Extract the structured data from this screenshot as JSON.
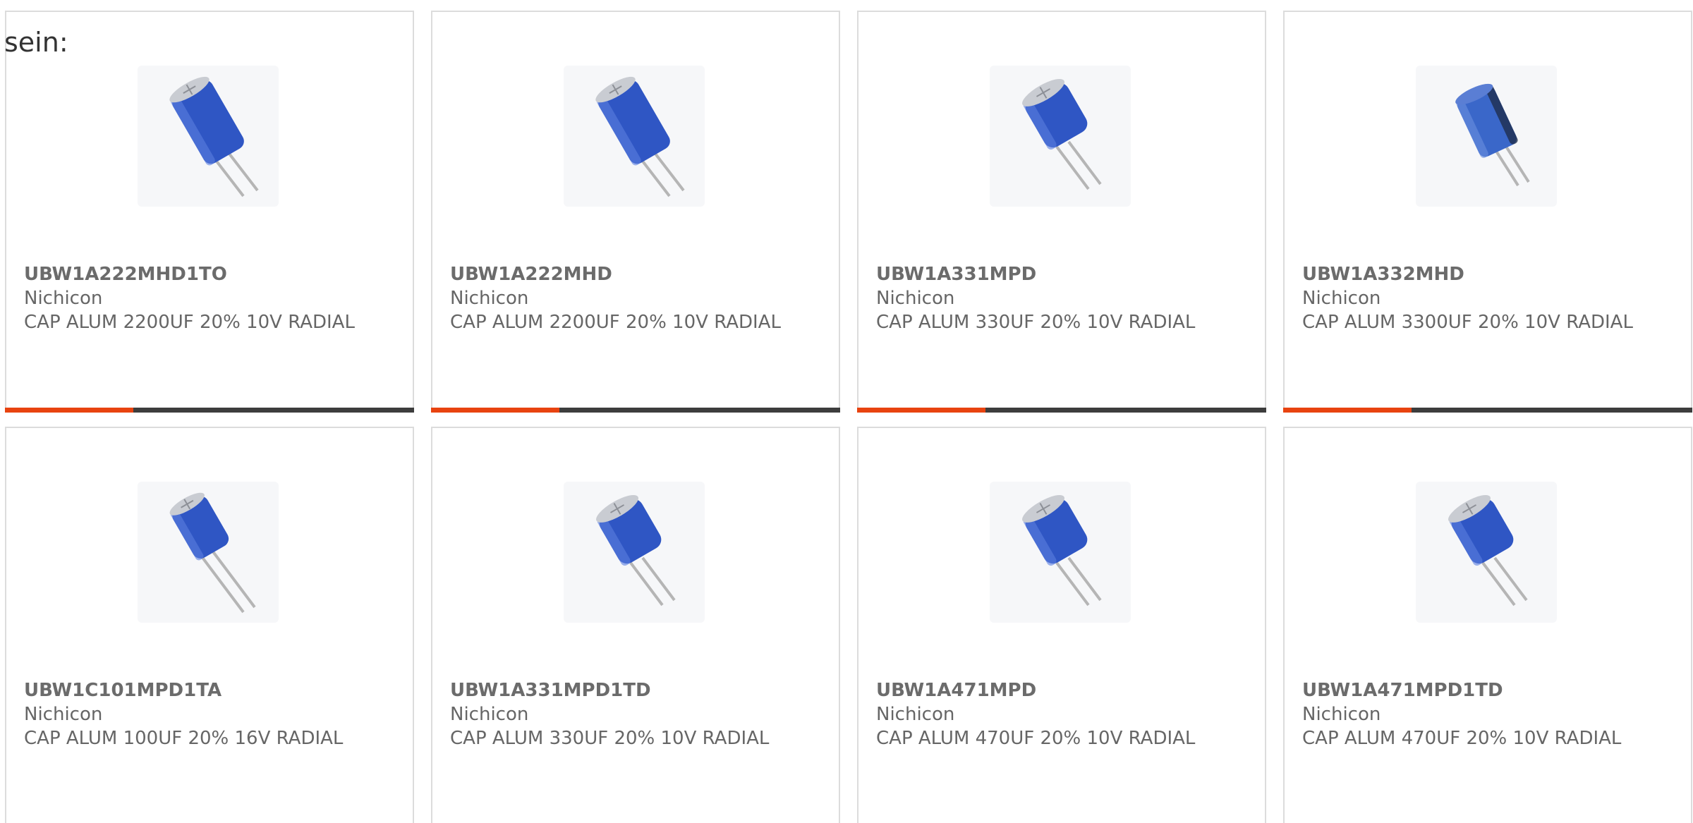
{
  "page": {
    "intro_text": "sein:"
  },
  "theme": {
    "accent_color": "#e84310",
    "bar_color": "#3d3d3d",
    "card_border": "#dcdcdc",
    "capacitor_color": "#2f56c4"
  },
  "products": [
    {
      "part_number": "UBW1A222MHD1TO",
      "manufacturer": "Nichicon",
      "description": "CAP ALUM 2200UF 20% 10V RADIAL",
      "image_icon": "radial-capacitor-icon"
    },
    {
      "part_number": "UBW1A222MHD",
      "manufacturer": "Nichicon",
      "description": "CAP ALUM 2200UF 20% 10V RADIAL",
      "image_icon": "radial-capacitor-icon"
    },
    {
      "part_number": "UBW1A331MPD",
      "manufacturer": "Nichicon",
      "description": "CAP ALUM 330UF 20% 10V RADIAL",
      "image_icon": "radial-capacitor-icon"
    },
    {
      "part_number": "UBW1A332MHD",
      "manufacturer": "Nichicon",
      "description": "CAP ALUM 3300UF 20% 10V RADIAL",
      "image_icon": "radial-capacitor-icon"
    },
    {
      "part_number": "UBW1C101MPD1TA",
      "manufacturer": "Nichicon",
      "description": "CAP ALUM 100UF 20% 16V RADIAL",
      "image_icon": "radial-capacitor-icon"
    },
    {
      "part_number": "UBW1A331MPD1TD",
      "manufacturer": "Nichicon",
      "description": "CAP ALUM 330UF 20% 10V RADIAL",
      "image_icon": "radial-capacitor-icon"
    },
    {
      "part_number": "UBW1A471MPD",
      "manufacturer": "Nichicon",
      "description": "CAP ALUM 470UF 20% 10V RADIAL",
      "image_icon": "radial-capacitor-icon"
    },
    {
      "part_number": "UBW1A471MPD1TD",
      "manufacturer": "Nichicon",
      "description": "CAP ALUM 470UF 20% 10V RADIAL",
      "image_icon": "radial-capacitor-icon"
    }
  ]
}
